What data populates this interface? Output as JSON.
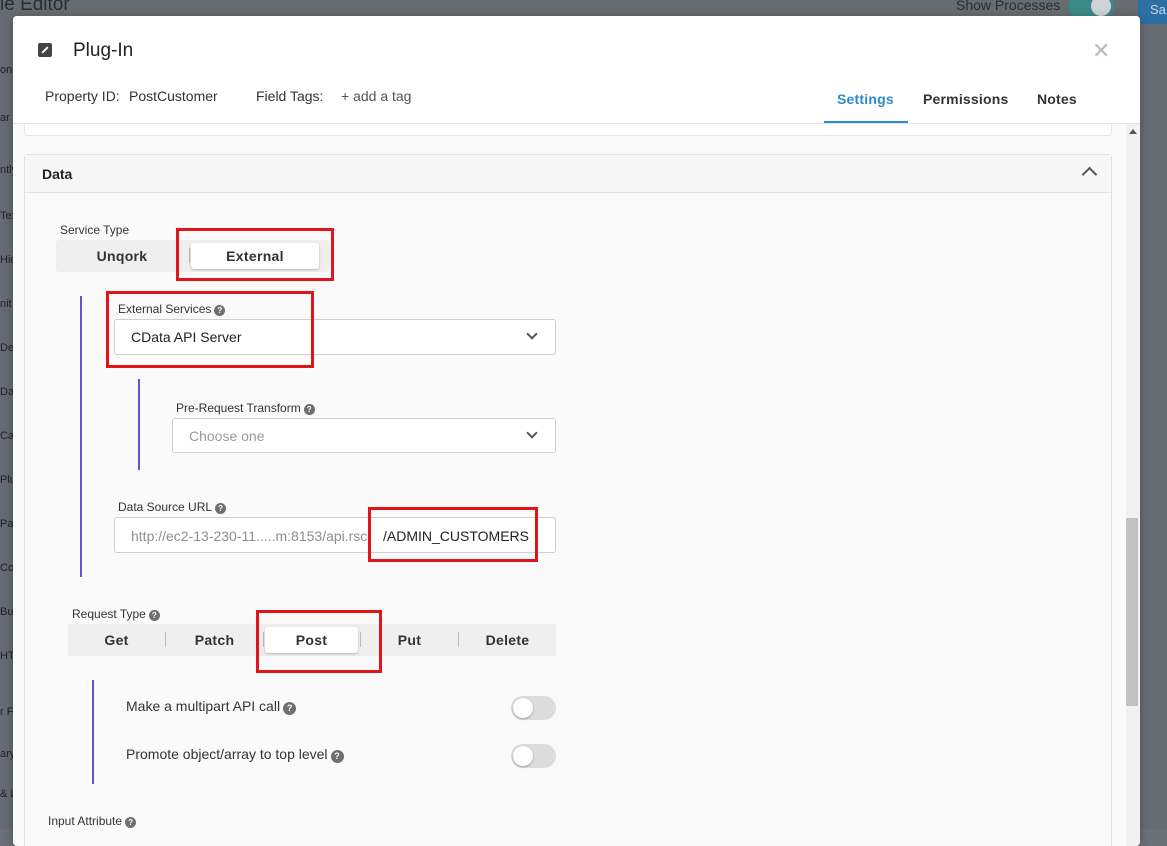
{
  "background": {
    "title": "le Editor",
    "show_processes": "Show Processes",
    "save_label": "Sa",
    "sidebar_fragments": [
      "on",
      "ar",
      "ntly",
      "Tex",
      "Hidd",
      "nit",
      "Dec",
      "Dat",
      "Calc",
      "Plug",
      "Pan",
      "Colu",
      "Butt",
      "HT",
      "r Fi",
      "ary",
      "& L"
    ]
  },
  "modal": {
    "title": "Plug-In",
    "property_id_label": "Property ID:",
    "property_id_value": "PostCustomer",
    "field_tags_label": "Field Tags:",
    "add_tag": "+ add a tag",
    "tabs": [
      "Settings",
      "Permissions",
      "Notes"
    ],
    "active_tab": "Settings"
  },
  "data_section": {
    "title": "Data",
    "service_type": {
      "label": "Service Type",
      "options": [
        "Unqork",
        "External"
      ],
      "selected": "External"
    },
    "external_services": {
      "label": "External Services",
      "value": "CData API Server"
    },
    "pre_request_transform": {
      "label": "Pre-Request Transform",
      "placeholder": "Choose one"
    },
    "data_source_url": {
      "label": "Data Source URL",
      "value_prefix": "http://ec2-13-230-11.....m:8153/api.rsc",
      "value_suffix": "/ADMIN_CUSTOMERS"
    },
    "request_type": {
      "label": "Request Type",
      "options": [
        "Get",
        "Patch",
        "Post",
        "Put",
        "Delete"
      ],
      "selected": "Post"
    },
    "toggles": [
      {
        "label": "Make a multipart API call",
        "on": false
      },
      {
        "label": "Promote object/array to top level",
        "on": false
      }
    ],
    "input_attribute_label": "Input Attribute"
  },
  "colors": {
    "accent": "#2d8bd0",
    "annotation_red": "#e0141b",
    "indent_line": "#6b4fd8"
  }
}
